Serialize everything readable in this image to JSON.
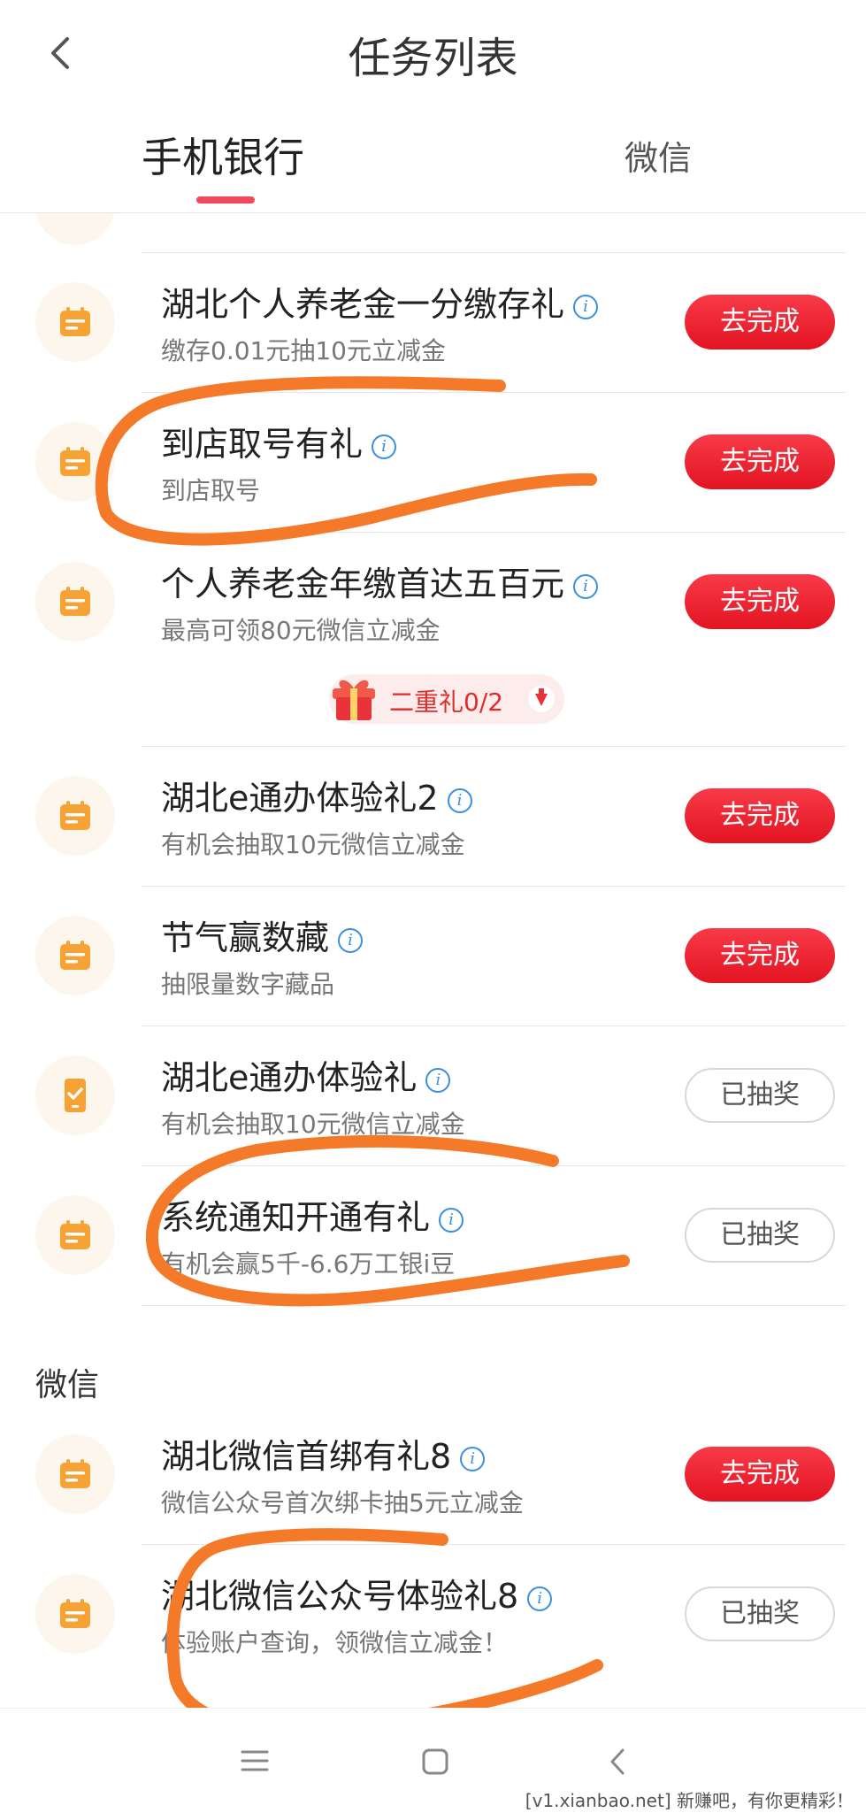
{
  "header": {
    "title": "任务列表",
    "tabs": [
      {
        "label": "手机银行",
        "active": true
      },
      {
        "label": "微信",
        "active": false
      }
    ]
  },
  "tasks": [
    {
      "title": "湖北个人养老金一分缴存礼",
      "subtitle": "缴存0.01元抽10元立减金",
      "button": "去完成",
      "state": "todo",
      "icon": "list-icon"
    },
    {
      "title": "到店取号有礼",
      "subtitle": "到店取号",
      "button": "去完成",
      "state": "todo",
      "icon": "list-icon"
    },
    {
      "title": "个人养老金年缴首达五百元",
      "subtitle": "最高可领80元微信立减金",
      "button": "去完成",
      "state": "todo",
      "icon": "list-icon"
    },
    {
      "title": "湖北e通办体验礼2",
      "subtitle": "有机会抽取10元微信立减金",
      "button": "去完成",
      "state": "todo",
      "icon": "list-icon"
    },
    {
      "title": "节气赢数藏",
      "subtitle": "抽限量数字藏品",
      "button": "去完成",
      "state": "todo",
      "icon": "list-icon"
    },
    {
      "title": "湖北e通办体验礼",
      "subtitle": "有机会抽取10元微信立减金",
      "button": "已抽奖",
      "state": "done",
      "icon": "phone-check-icon"
    },
    {
      "title": "系统通知开通有礼",
      "subtitle": "有机会赢5千-6.6万工银i豆",
      "button": "已抽奖",
      "state": "done",
      "icon": "list-icon"
    }
  ],
  "gift": {
    "label": "二重礼0/2"
  },
  "section_wechat": {
    "heading": "微信",
    "tasks": [
      {
        "title": "湖北微信首绑有礼8",
        "subtitle": "微信公众号首次绑卡抽5元立减金",
        "button": "去完成",
        "state": "todo",
        "icon": "list-icon"
      },
      {
        "title": "湖北微信公众号体验礼8",
        "subtitle": "体验账户查询，领微信立减金！",
        "button": "已抽奖",
        "state": "done",
        "icon": "list-icon"
      }
    ]
  },
  "watermark": "[v1.xianbao.net] 新赚吧，有你更精彩！",
  "colors": {
    "accent": "#e31422",
    "icon_orange": "#f7a234",
    "info_blue": "#3a8fe0",
    "annotation_orange": "#f47a2a"
  }
}
